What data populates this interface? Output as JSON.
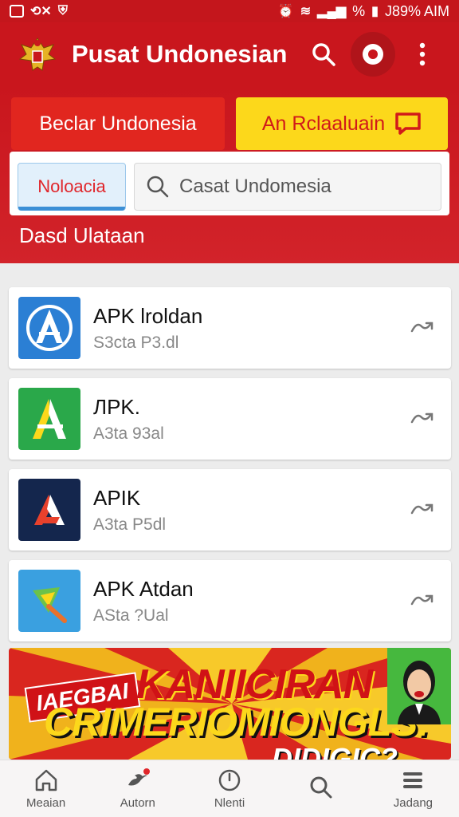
{
  "status_bar": {
    "battery_percent": "%",
    "time": "J89% AIM"
  },
  "header": {
    "title": "Pusat Undonesian",
    "icons": [
      "emblem-logo",
      "search-icon",
      "record-icon",
      "more-vertical-icon"
    ]
  },
  "top_tabs": {
    "left_label": "Beclar Undonesia",
    "right_label": "An Rclaaluain"
  },
  "search": {
    "chip_label": "Noloacia",
    "placeholder": "Casat Undomesia"
  },
  "section_title": "Dasd Ulataan",
  "apps": [
    {
      "name": "APK lroldan",
      "sub": "S3cta P3.dl",
      "icon": "blue-a-icon",
      "color": "#2b7fd4"
    },
    {
      "name": "ЛPK.",
      "sub": "A3ta 93al",
      "icon": "green-a-icon",
      "color": "#2aa84a"
    },
    {
      "name": "APIK",
      "sub": "A3ta P5dl",
      "icon": "navy-a-icon",
      "color": "#14264d"
    },
    {
      "name": "APK Atdan",
      "sub": "ASta ?Ual",
      "icon": "colorful-a-icon",
      "color": "#3aa0e0"
    }
  ],
  "banner": {
    "tag": "IAEGBAI",
    "headline": "KANIICIRAN",
    "sub_headline": "CRIMERIOMIONGLS:",
    "sub_headline2": "DIDIGIC?"
  },
  "bottom_nav": [
    {
      "label": "Meaian",
      "icon": "home-icon"
    },
    {
      "label": "Autorn",
      "icon": "bird-icon"
    },
    {
      "label": "Nlenti",
      "icon": "clock-icon"
    },
    {
      "label": "",
      "icon": "search-icon"
    },
    {
      "label": "Jadang",
      "icon": "menu-icon"
    }
  ],
  "colors": {
    "primary_red": "#c9161d",
    "yellow": "#fcd81b"
  }
}
